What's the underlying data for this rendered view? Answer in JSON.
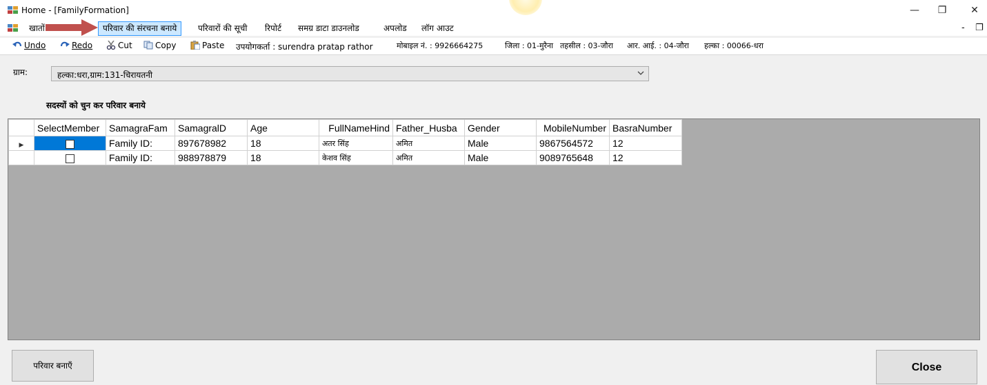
{
  "window": {
    "title": "Home - [FamilyFormation]",
    "minimize_glyph": "—",
    "restore_glyph": "❐",
    "close_glyph": "✕"
  },
  "menu": {
    "items": [
      {
        "label": "खातों"
      },
      {
        "label": "परिवार की संरचना बनाये"
      },
      {
        "label": "परिवारों की सूची"
      },
      {
        "label": "रिपोर्ट"
      },
      {
        "label": "समग्र डाटा डाउनलोड"
      },
      {
        "label": "अपलोड"
      },
      {
        "label": "लॉग आउट"
      }
    ],
    "active_item": "परिवार की संरचना बनाये",
    "mdi_minimize": "-",
    "mdi_restore": "❐"
  },
  "toolbar": {
    "undo": "Undo",
    "redo": "Redo",
    "cut": "Cut",
    "copy": "Copy",
    "paste": "Paste",
    "user_info": "उपयोगकर्ता : surendra pratap rathor",
    "mobile_info": "मोबाइल नं. : 9926664275",
    "district_info": "जिला : 01-मुरैना",
    "tehsil_info": "तहसील : 03-जौरा",
    "ri_info": "आर. आई. : 04-जौरा",
    "halka_info": "हल्का : 00066-धरा"
  },
  "form": {
    "gram_label": "ग्राम:",
    "gram_value": "हल्का:धरा,ग्राम:131-चिरायतनी",
    "instruction": "सदस्यों को चुन कर परिवार बनाये"
  },
  "grid": {
    "columns": [
      "SelectMember",
      "SamagraFam",
      "SamagralD",
      "Age",
      "FullNameHind",
      "Father_Husba",
      "Gender",
      "MobileNumber",
      "BasraNumber"
    ],
    "rows": [
      {
        "selected": false,
        "family": "Family ID:",
        "samagra_id": "897678982",
        "age": "18",
        "name": "अतर सिंह",
        "father": "अमित",
        "gender": "Male",
        "mobile": "9867564572",
        "basra": "12"
      },
      {
        "selected": false,
        "family": "Family ID:",
        "samagra_id": "988978879",
        "age": "18",
        "name": "केशव सिंह",
        "father": "अमित",
        "gender": "Male",
        "mobile": "9089765648",
        "basra": "12"
      }
    ]
  },
  "buttons": {
    "create_family": "परिवार बनाएँ",
    "close": "Close"
  },
  "colors": {
    "accent": "#0078d7",
    "menu_active_bg": "#cce8ff",
    "arrow": "#c0504d",
    "grid_bg": "#ababab"
  },
  "icons": {
    "app": "app-window-icon",
    "undo": "undo-icon",
    "redo": "redo-icon",
    "cut": "scissors-icon",
    "copy": "copy-icon",
    "paste": "paste-icon",
    "row_current": "row-pointer-icon",
    "combo": "chevron-down-icon"
  }
}
